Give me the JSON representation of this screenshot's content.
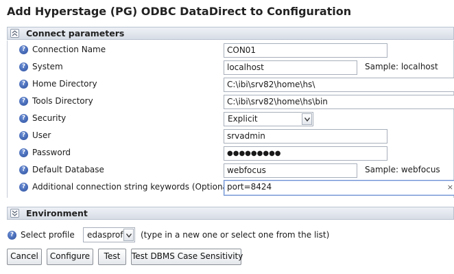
{
  "title": "Add Hyperstage (PG) ODBC DataDirect to Configuration",
  "sections": {
    "connect": "Connect parameters",
    "environment": "Environment"
  },
  "params": [
    {
      "label": "Connection Name",
      "value": "CON01"
    },
    {
      "label": "System",
      "value": "localhost",
      "sample": "Sample: localhost"
    },
    {
      "label": "Home Directory",
      "value": "C:\\ibi\\srv82\\home\\hs\\"
    },
    {
      "label": "Tools Directory",
      "value": "C:\\ibi\\srv82\\home\\hs\\bin"
    },
    {
      "label": "Security",
      "value": "Explicit"
    },
    {
      "label": "User",
      "value": "srvadmin"
    },
    {
      "label": "Password",
      "value": "●●●●●●●●●"
    },
    {
      "label": "Default Database",
      "value": "webfocus",
      "sample": "Sample: webfocus"
    },
    {
      "label": "Additional connection string keywords (Optional)",
      "value": "port=8424",
      "clear": "×"
    }
  ],
  "profile": {
    "label": "Select profile",
    "value": "edasprof",
    "hint": "(type in a new one or select one from the list)"
  },
  "buttons": {
    "cancel": "Cancel",
    "configure": "Configure",
    "test": "Test",
    "test_case": "Test DBMS Case Sensitivity"
  },
  "icons": {
    "help": "?",
    "collapse": "double-chevron-up-icon",
    "expand": "double-chevron-down-icon",
    "dropdown": "chevron-down-icon"
  }
}
